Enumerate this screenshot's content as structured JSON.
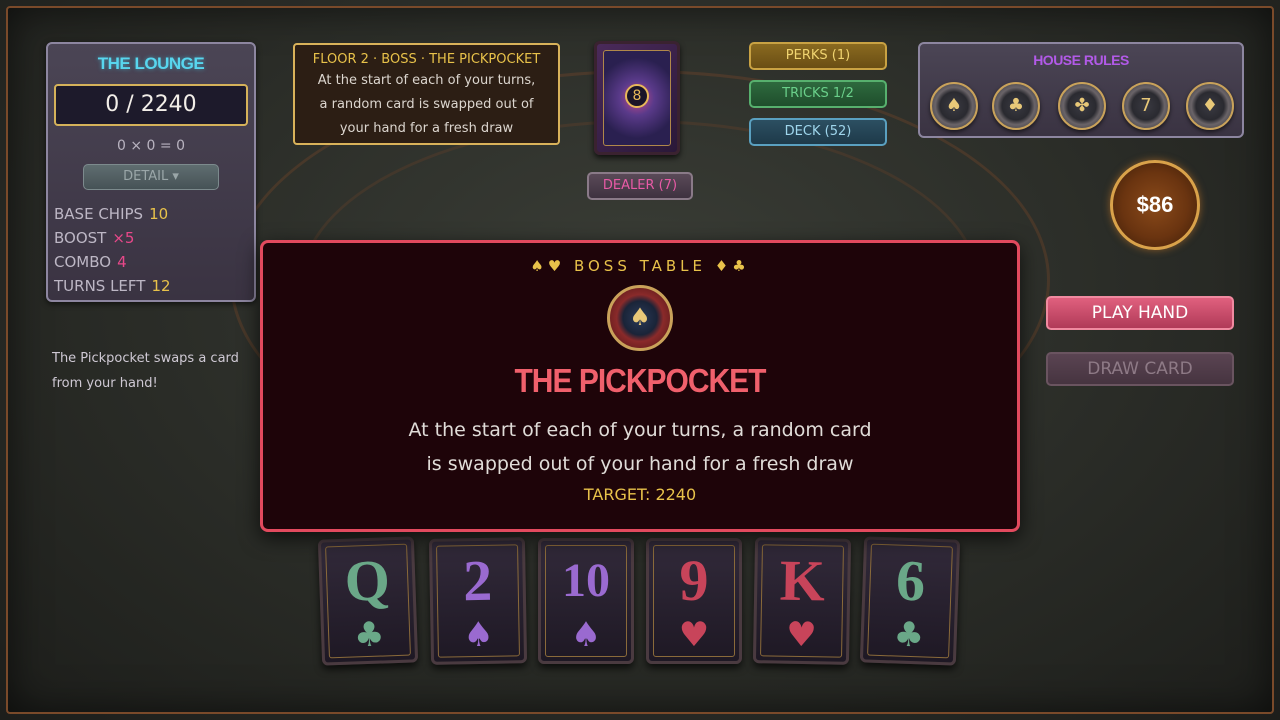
{
  "score_panel": {
    "title": "THE LOUNGE",
    "score": "0 / 2240",
    "calc": "0 × 0 = 0",
    "detail_label": "DETAIL ▾",
    "stats": [
      {
        "label": "BASE CHIPS",
        "value": "10",
        "color": "yellow"
      },
      {
        "label": "BOOST",
        "value": "×5",
        "color": "pink"
      },
      {
        "label": "COMBO",
        "value": "4",
        "color": "pink"
      },
      {
        "label": "TURNS LEFT",
        "value": "12",
        "color": "yellow"
      }
    ]
  },
  "boss_message": "The Pickpocket swaps a card from your hand!",
  "boss_card": {
    "header": "FLOOR 2 · BOSS · THE PICKPOCKET",
    "description": "At the start of each of your turns, a random card is swapped out of your hand for a fresh draw"
  },
  "dealer": {
    "card_badge": "8",
    "label": "DEALER (7)"
  },
  "side_buttons": {
    "perks": "PERKS (1)",
    "tricks": "TRICKS 1/2",
    "deck": "DECK (52)"
  },
  "house_rules": {
    "title": "HOUSE RULES",
    "chips": [
      {
        "icon": "spade-chip-icon",
        "glyph": "♠"
      },
      {
        "icon": "club-chip-icon",
        "glyph": "♣"
      },
      {
        "icon": "clover-chip-icon",
        "glyph": "✤"
      },
      {
        "icon": "seven-chip-icon",
        "glyph": "7"
      },
      {
        "icon": "bell-chip-icon",
        "glyph": "♦"
      }
    ]
  },
  "money": "$86",
  "actions": {
    "play": "PLAY HAND",
    "draw": "DRAW CARD"
  },
  "hand": [
    {
      "rank": "Q",
      "suit": "♣",
      "color": "green"
    },
    {
      "rank": "2",
      "suit": "♠",
      "color": "purple"
    },
    {
      "rank": "10",
      "suit": "♠",
      "color": "purple"
    },
    {
      "rank": "9",
      "suit": "♥",
      "color": "red"
    },
    {
      "rank": "K",
      "suit": "♥",
      "color": "red"
    },
    {
      "rank": "6",
      "suit": "♣",
      "color": "green"
    }
  ],
  "modal": {
    "kicker": "♠♥ BOSS TABLE ♦♣",
    "emblem": "♠",
    "name": "THE PICKPOCKET",
    "description": "At the start of each of your turns, a random card is swapped out of your hand for a fresh draw",
    "target": "TARGET: 2240"
  },
  "colors": {
    "accent_red": "#e24a5e",
    "gold": "#e8c24a",
    "cyan": "#58d6ee",
    "pink": "#e8488a"
  }
}
